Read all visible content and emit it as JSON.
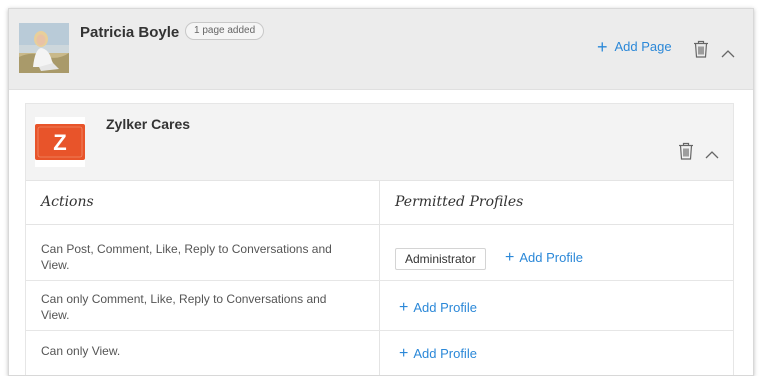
{
  "user": {
    "name": "Patricia Boyle",
    "badge": "1 page added",
    "add_page_label": "Add Page"
  },
  "page": {
    "name": "Zylker Cares",
    "logo_letter": "Z",
    "logo_color": "#e8542a"
  },
  "table": {
    "col_actions": "Actions",
    "col_profiles": "Permitted Profiles",
    "rows": [
      {
        "action": "Can Post, Comment, Like, Reply to Conversations and View.",
        "profile": "Administrator",
        "add_label": "Add Profile"
      },
      {
        "action": "Can only Comment, Like, Reply to Conversations and View.",
        "add_label": "Add Profile"
      },
      {
        "action": "Can only View.",
        "add_label": "Add Profile"
      }
    ]
  },
  "colors": {
    "accent": "#2b88d8",
    "header_bg": "#ececec"
  }
}
